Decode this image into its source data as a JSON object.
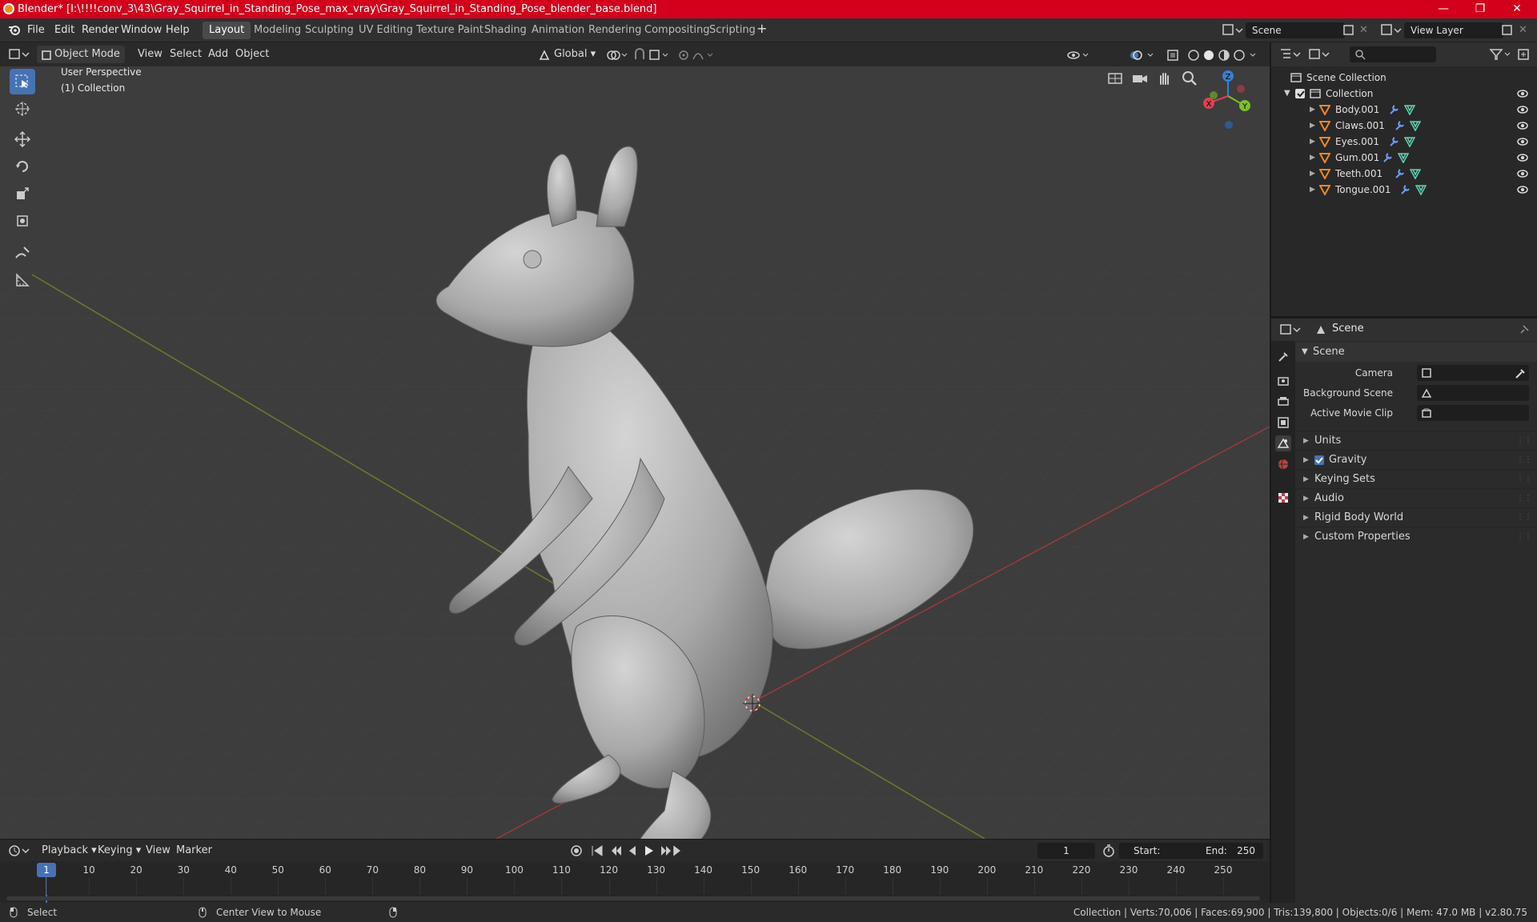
{
  "titlebar": {
    "title": "Blender* [I:\\!!!!conv_3\\43\\Gray_Squirrel_in_Standing_Pose_max_vray\\Gray_Squirrel_in_Standing_Pose_blender_base.blend]"
  },
  "menu": {
    "file": "File",
    "edit": "Edit",
    "render": "Render",
    "window": "Window",
    "help": "Help"
  },
  "workspaces": [
    "Layout",
    "Modeling",
    "Sculpting",
    "UV Editing",
    "Texture Paint",
    "Shading",
    "Animation",
    "Rendering",
    "Compositing",
    "Scripting"
  ],
  "scene_field": "Scene",
  "view_layer_field": "View Layer",
  "viewport_header": {
    "mode": "Object Mode",
    "view": "View",
    "select": "Select",
    "add": "Add",
    "object": "Object",
    "orientation": "Global"
  },
  "viewport": {
    "perspective_label": "User Perspective",
    "collection_label": "(1) Collection",
    "gizmo": {
      "x": "X",
      "y": "Y",
      "z": "Z"
    }
  },
  "outliner": {
    "scene_collection": "Scene Collection",
    "collection": "Collection",
    "objects": [
      "Body.001",
      "Claws.001",
      "Eyes.001",
      "Gum.001",
      "Teeth.001",
      "Tongue.001"
    ]
  },
  "properties": {
    "header_title": "Scene",
    "panel_title": "Scene",
    "fields": {
      "camera": "Camera",
      "background_scene": "Background Scene",
      "active_movie_clip": "Active Movie Clip"
    },
    "sections": [
      "Units",
      "Gravity",
      "Keying Sets",
      "Audio",
      "Rigid Body World",
      "Custom Properties"
    ]
  },
  "timeline": {
    "playback": "Playback",
    "keying": "Keying",
    "view": "View",
    "marker": "Marker",
    "current_frame": "1",
    "start_label": "Start:",
    "start": "1",
    "end_label": "End:",
    "end": "250",
    "ticks": [
      "1",
      "10",
      "20",
      "30",
      "40",
      "50",
      "60",
      "70",
      "80",
      "90",
      "100",
      "110",
      "120",
      "130",
      "140",
      "150",
      "160",
      "170",
      "180",
      "190",
      "200",
      "210",
      "220",
      "230",
      "240",
      "250"
    ]
  },
  "statusbar": {
    "select": "Select",
    "center": "Center View to Mouse",
    "stats": "Collection | Verts:70,006 | Faces:69,900 | Tris:139,800 | Objects:0/6 | Mem: 47.0 MB | v2.80.75"
  },
  "colors": {
    "accent": "#4772b3",
    "title": "#d3001b",
    "object_icon": "#e88a2e",
    "mesh_data": "#5fd4b5",
    "modifier": "#6e9ff5"
  }
}
